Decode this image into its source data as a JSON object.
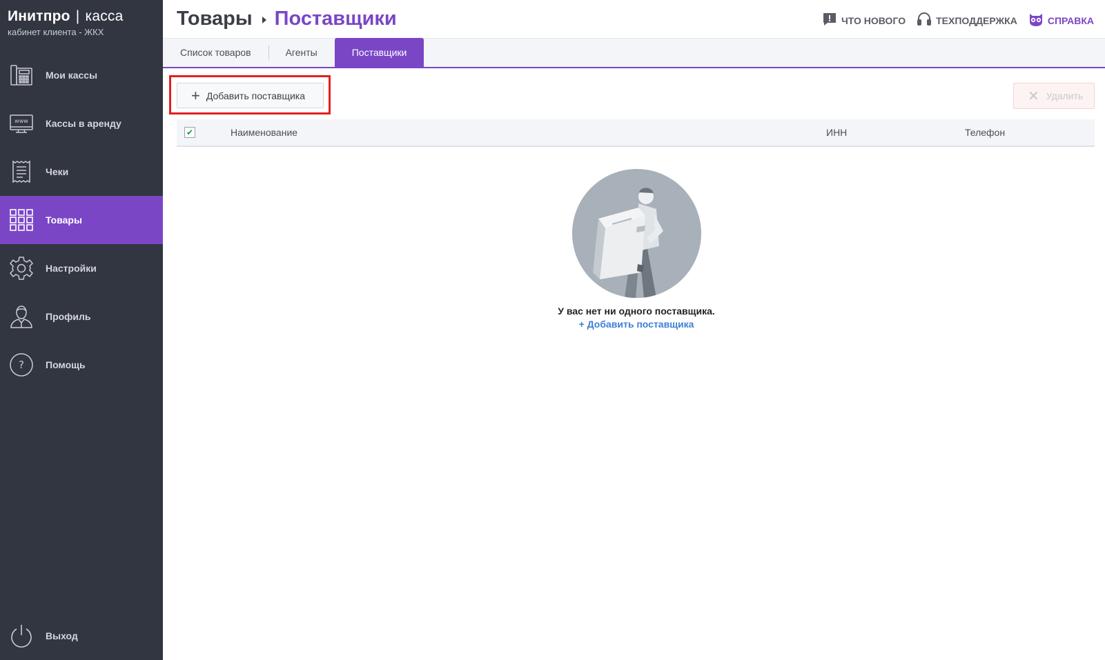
{
  "brand": {
    "name": "Инитпро",
    "separator": "|",
    "product": "касса",
    "subtitle": "кабинет клиента - ЖКХ"
  },
  "sidebar": {
    "items": [
      {
        "label": "Мои кассы",
        "icon": "cash-register-icon"
      },
      {
        "label": "Кассы в аренду",
        "icon": "www-monitor-icon"
      },
      {
        "label": "Чеки",
        "icon": "receipt-icon"
      },
      {
        "label": "Товары",
        "icon": "grid-icon",
        "active": true
      },
      {
        "label": "Настройки",
        "icon": "gear-icon"
      },
      {
        "label": "Профиль",
        "icon": "user-icon"
      },
      {
        "label": "Помощь",
        "icon": "help-icon"
      }
    ],
    "logout": {
      "label": "Выход",
      "icon": "power-icon"
    }
  },
  "header": {
    "breadcrumb_root": "Товары",
    "breadcrumb_current": "Поставщики",
    "links": [
      {
        "label": "ЧТО НОВОГО",
        "icon": "chat-alert-icon"
      },
      {
        "label": "ТЕХПОДДЕРЖКА",
        "icon": "headset-icon"
      },
      {
        "label": "СПРАВКА",
        "icon": "owl-icon"
      }
    ]
  },
  "tabs": [
    {
      "label": "Список товаров"
    },
    {
      "label": "Агенты"
    },
    {
      "label": "Поставщики",
      "active": true
    }
  ],
  "toolbar": {
    "add_label": "Добавить поставщика",
    "delete_label": "Удалить"
  },
  "table": {
    "columns": [
      "Наименование",
      "ИНН",
      "Телефон"
    ],
    "select_all_checked": true
  },
  "empty_state": {
    "message": "У вас нет ни одного поставщика.",
    "link": "+ Добавить поставщика"
  },
  "colors": {
    "accent": "#7a46c6",
    "sidebar": "#323641",
    "link": "#3d7fd6",
    "highlight": "#e41e1e"
  }
}
